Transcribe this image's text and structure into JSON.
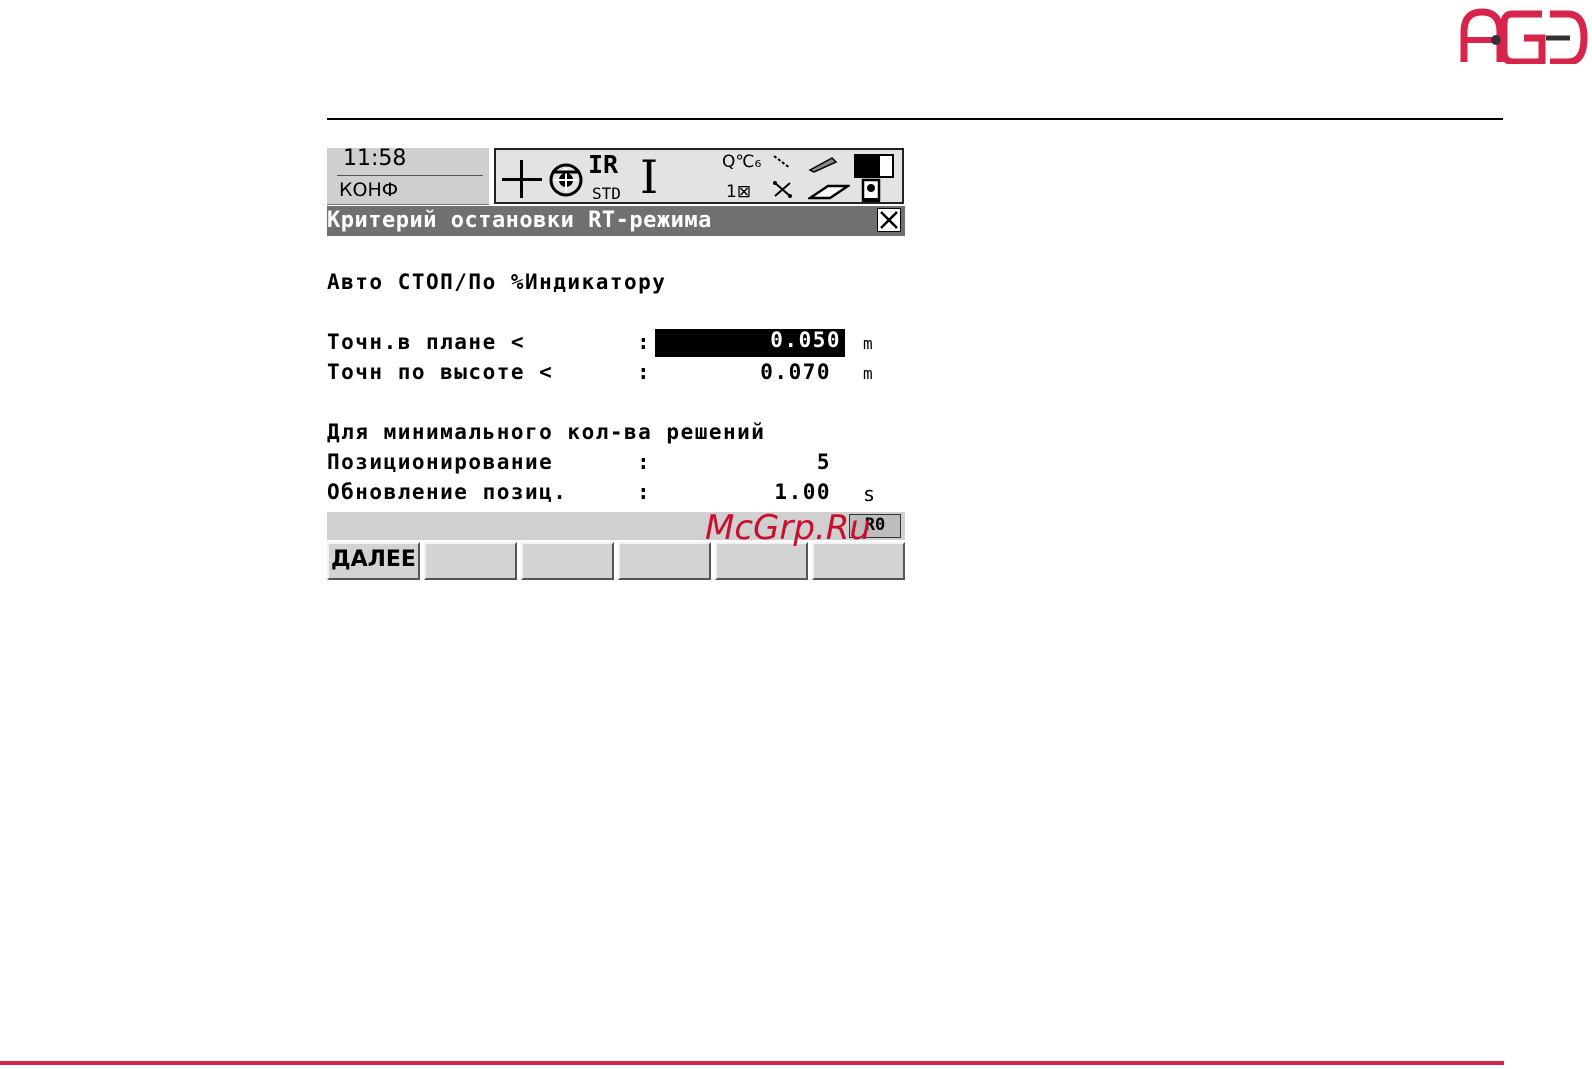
{
  "brand": {
    "logo_text": "AGED",
    "accent": "#d6244b"
  },
  "watermark": "McGrp.Ru",
  "status": {
    "time": "11:58",
    "mode": "КОНФ",
    "prism": "IR",
    "reflector": "STD",
    "q_label": "Q℃₆",
    "count": "1⊠",
    "icons": [
      "crosshair-icon",
      "satellite-icon",
      "cursor-icon",
      "line-icon",
      "pen-icon",
      "battery-icon",
      "card-icon",
      "instrument-icon"
    ]
  },
  "dialog": {
    "title": "Критерий остановки RT-режима",
    "close_symbol": "✕"
  },
  "form": {
    "mode_line": "Авто СТОП/По %Индикатору",
    "h_label": "Точн.в плане <",
    "h_value": "0.050",
    "h_unit": "m",
    "v_label": "Точн по высоте <",
    "v_value": "0.070",
    "v_unit": "m",
    "section": "Для минимального кол-ва решений",
    "pos_label": "Позиционирование",
    "pos_value": "5",
    "upd_label": "Обновление позиц.",
    "upd_value": "1.00",
    "upd_unit": "s",
    "colon": ":"
  },
  "message_bar": {
    "box_text": "R0"
  },
  "softkeys": [
    "ДАЛЕЕ",
    "",
    "",
    "",
    "",
    ""
  ]
}
